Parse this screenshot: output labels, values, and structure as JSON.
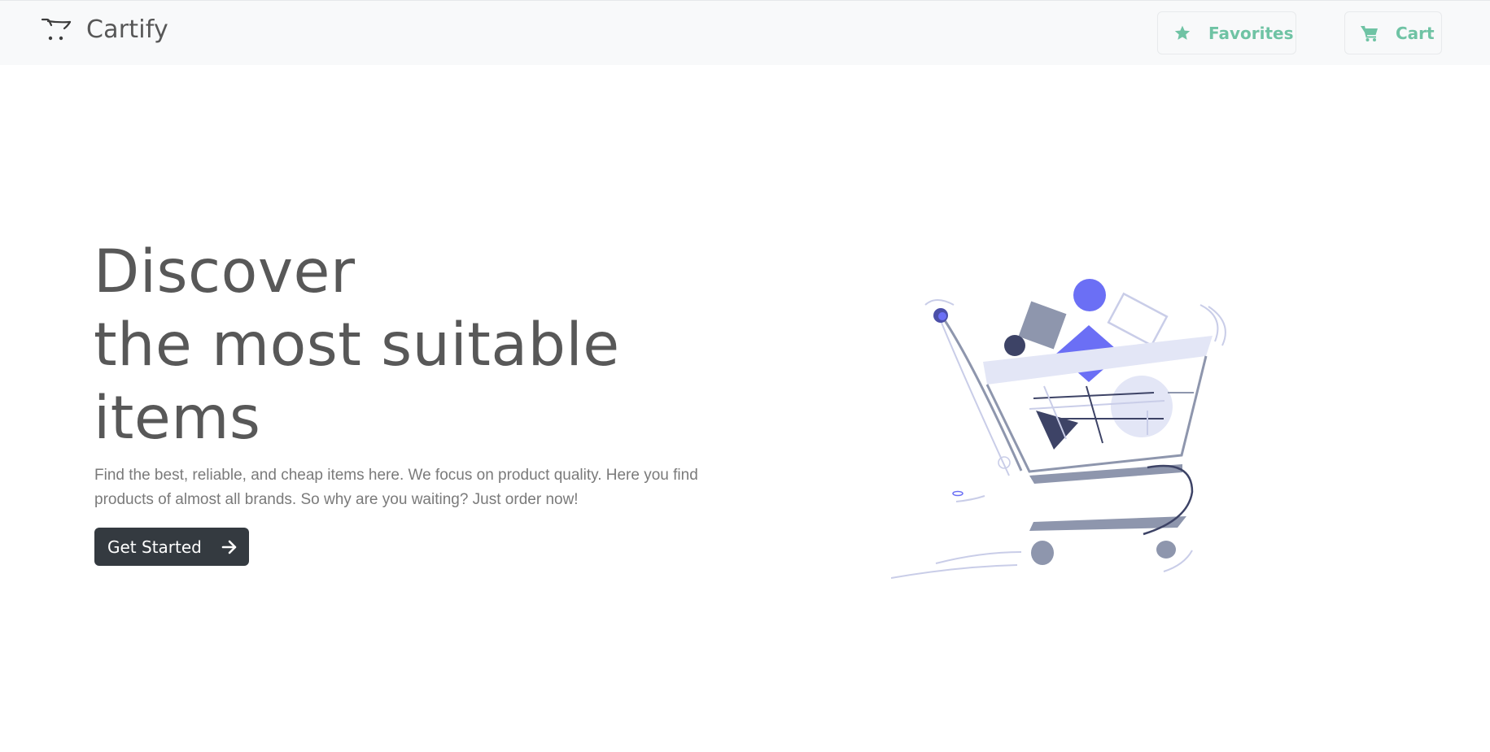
{
  "app": {
    "brand_name": "Cartify",
    "brand_icon": "shopping-cart-logo-icon",
    "accent_color": "#6fc3a4"
  },
  "nav": {
    "favorites_label": "Favorites",
    "favorites_icon": "star-icon",
    "cart_label": "Cart",
    "cart_icon": "cart-icon"
  },
  "hero": {
    "title_line1": "Discover",
    "title_line2": "the most suitable",
    "title_line3": "items",
    "description": "Find the best, reliable, and cheap items here. We focus on product quality. Here you find products of almost all brands. So why are you waiting? Just order now!",
    "cta_label": "Get Started",
    "cta_icon": "arrow-right-icon",
    "illustration": "shopping-cart-illustration"
  }
}
